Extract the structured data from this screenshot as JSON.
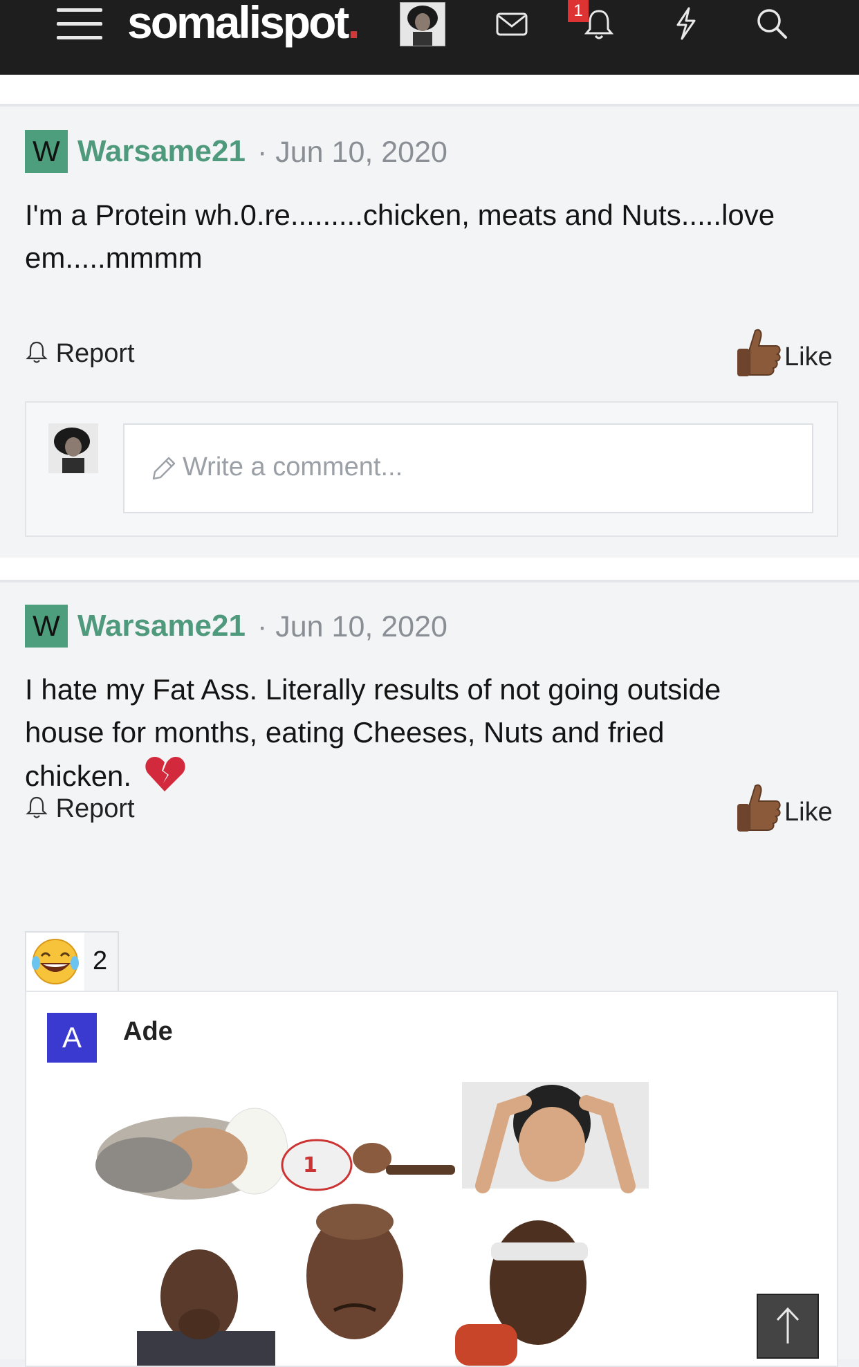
{
  "header": {
    "logo_text": "somalispot",
    "logo_dot": ".",
    "notification_count": "1"
  },
  "icons": {
    "menu": "hamburger-icon",
    "messages": "envelope-icon",
    "notifications": "bell-icon",
    "whats_new": "lightning-icon",
    "search": "search-icon"
  },
  "posts": [
    {
      "avatar_letter": "W",
      "author": "Warsame21",
      "date": "· Jun 10, 2020",
      "text_line1": "I'm a Protein wh.0.re.........chicken, meats and Nuts.....love",
      "text_line2": "em.....mmmm",
      "report_label": "Report",
      "like_label": "Like",
      "comment_placeholder": "Write a comment..."
    },
    {
      "avatar_letter": "W",
      "author": "Warsame21",
      "date": "· Jun 10, 2020",
      "text_line1": "I hate my Fat Ass. Literally results of not going outside",
      "text_line2": "house for months, eating Cheeses, Nuts and fried",
      "text_line3": "chicken.",
      "report_label": "Report",
      "like_label": "Like",
      "reaction_count": "2",
      "reply": {
        "avatar_letter": "A",
        "author": "Ade"
      }
    }
  ],
  "colors": {
    "topbar": "#1e1e1e",
    "username": "#4f9a7d",
    "avatar_w": "#4d9e7c",
    "avatar_a": "#3a3ad0",
    "badge": "#d33333"
  }
}
